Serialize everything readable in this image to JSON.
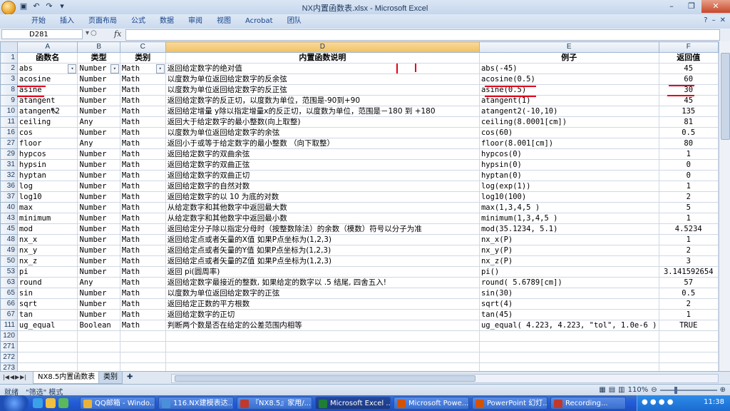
{
  "window": {
    "title": "NX内置函数表.xlsx - Microsoft Excel"
  },
  "ribbon": {
    "tabs": [
      "开始",
      "插入",
      "页面布局",
      "公式",
      "数据",
      "审阅",
      "视图",
      "Acrobat",
      "团队"
    ]
  },
  "formula_bar": {
    "name_box": "D281",
    "fx": "fx",
    "value": ""
  },
  "columns": [
    "A",
    "B",
    "C",
    "D",
    "E",
    "F"
  ],
  "header_row": {
    "row": "1",
    "cells": [
      "函数名",
      "类型",
      "类别",
      "内置函数说明",
      "例子",
      "返回值"
    ]
  },
  "rows": [
    {
      "row": "2",
      "name": "abs",
      "type": "Number",
      "category": "Math",
      "desc": "返回给定数字的绝对值",
      "example": "abs(-45)",
      "result": "45"
    },
    {
      "row": "3",
      "name": "acosine",
      "type": "Number",
      "category": "Math",
      "desc": "以度数为单位返回给定数字的反余弦",
      "example": "acosine(0.5)",
      "result": "60"
    },
    {
      "row": "8",
      "name": "asine",
      "type": "Number",
      "category": "Math",
      "desc": "以度数为单位返回给定数字的反正弦",
      "example": "asine(0.5)",
      "result": "30"
    },
    {
      "row": "9",
      "name": "atangent",
      "type": "Number",
      "category": "Math",
      "desc": "返回给定数字的反正切，以度数为单位，范围是-90到+90",
      "example": "atangent(1)",
      "result": "45"
    },
    {
      "row": "10",
      "name": "atangent2",
      "type": "Number",
      "category": "Math",
      "desc": "返回给定增量 y除以指定增量x的反正切，以度数为单位，范围是－180 到 +180",
      "example": "atangent2(-10,10)",
      "result": "135"
    },
    {
      "row": "11",
      "name": "ceiling",
      "type": "Any",
      "category": "Math",
      "desc": "返回大于给定数字的最小整数(向上取整)",
      "example": "ceiling(8.0001[cm])",
      "result": "81"
    },
    {
      "row": "16",
      "name": "cos",
      "type": "Number",
      "category": "Math",
      "desc": "以度数为单位返回给定数字的余弦",
      "example": "cos(60)",
      "result": "0.5"
    },
    {
      "row": "27",
      "name": "floor",
      "type": "Any",
      "category": "Math",
      "desc": "返回小于或等于给定数字的最小整数 （向下取整）",
      "example": "floor(8.001[cm])",
      "result": "80"
    },
    {
      "row": "29",
      "name": "hypcos",
      "type": "Number",
      "category": "Math",
      "desc": "返回给定数字的双曲余弦",
      "example": "hypcos(0)",
      "result": "1"
    },
    {
      "row": "31",
      "name": "hypsin",
      "type": "Number",
      "category": "Math",
      "desc": "返回给定数字的双曲正弦",
      "example": "hypsin(0)",
      "result": "0"
    },
    {
      "row": "32",
      "name": "hyptan",
      "type": "Number",
      "category": "Math",
      "desc": "返回给定数字的双曲正切",
      "example": "hyptan(0)",
      "result": "0"
    },
    {
      "row": "36",
      "name": "log",
      "type": "Number",
      "category": "Math",
      "desc": "返回给定数字的自然对数",
      "example": "log(exp(1))",
      "result": "1"
    },
    {
      "row": "37",
      "name": "log10",
      "type": "Number",
      "category": "Math",
      "desc": "返回给定数字的以 10 为底的对数",
      "example": "log10(100)",
      "result": "2"
    },
    {
      "row": "40",
      "name": "max",
      "type": "Number",
      "category": "Math",
      "desc": "从给定数字和其他数字中返回最大数",
      "example": "max(1,3,4,5 )",
      "result": "5"
    },
    {
      "row": "43",
      "name": "minimum",
      "type": "Number",
      "category": "Math",
      "desc": "从给定数字和其他数字中返回最小数",
      "example": "minimum(1,3,4,5 )",
      "result": "1"
    },
    {
      "row": "45",
      "name": "mod",
      "type": "Number",
      "category": "Math",
      "desc": "返回给定分子除以指定分母时（按整数除法）的余数（模数）符号以分子为准",
      "example": "mod(35.1234, 5.1)",
      "result": "4.5234"
    },
    {
      "row": "48",
      "name": "nx_x",
      "type": "Number",
      "category": "Math",
      "desc": "返回给定点或者矢量的X值 如果P点坐标为(1,2,3)",
      "example": "nx_x(P)",
      "result": "1"
    },
    {
      "row": "49",
      "name": "nx_y",
      "type": "Number",
      "category": "Math",
      "desc": "返回给定点或者矢量的Y值 如果P点坐标为(1,2,3)",
      "example": "nx_y(P)",
      "result": "2"
    },
    {
      "row": "50",
      "name": "nx_z",
      "type": "Number",
      "category": "Math",
      "desc": "返回给定点或者矢量的Z值 如果P点坐标为(1,2,3)",
      "example": "nx_z(P)",
      "result": "3"
    },
    {
      "row": "53",
      "name": "pi",
      "type": "Number",
      "category": "Math",
      "desc": "返回 pi(圆周率)",
      "example": "pi()",
      "result": "3.141592654"
    },
    {
      "row": "63",
      "name": "round",
      "type": "Any",
      "category": "Math",
      "desc": "返回给定数字最接近的整数, 如果给定的数字以 .5 结尾, 四舍五入!",
      "example": "round( 5.6789[cm])",
      "result": "57"
    },
    {
      "row": "65",
      "name": "sin",
      "type": "Number",
      "category": "Math",
      "desc": "以度数为单位返回给定数字的正弦",
      "example": "sin(30)",
      "result": "0.5"
    },
    {
      "row": "66",
      "name": "sqrt",
      "type": "Number",
      "category": "Math",
      "desc": "返回给定正数的平方根数",
      "example": "sqrt(4)",
      "result": "2"
    },
    {
      "row": "67",
      "name": "tan",
      "type": "Number",
      "category": "Math",
      "desc": "返回给定数字的正切",
      "example": "tan(45)",
      "result": "1"
    },
    {
      "row": "111",
      "name": "ug_equal",
      "type": "Boolean",
      "category": "Math",
      "desc": "判断两个数是否在给定的公差范围内相等",
      "example": "ug_equal( 4.223, 4.223, \"tol\", 1.0e-6 )",
      "result": "TRUE"
    }
  ],
  "empty_rows": [
    "120",
    "271",
    "272",
    "273",
    "274"
  ],
  "sheets": {
    "active": "NX8.5内置函数表",
    "other": "类别"
  },
  "status": {
    "ready": "就绪",
    "mode": "\"筛选\" 模式",
    "zoom": "110%"
  },
  "taskbar": {
    "items": [
      "QQ邮箱 - Windo...",
      "116.NX建模表达...",
      "『NX8.5』家用/...",
      "Microsoft Excel ...",
      "Microsoft Powe...",
      "PowerPoint 幻灯...",
      "Recording..."
    ],
    "clock": "11:38"
  },
  "colors": {
    "annotation_red": "#e0001a",
    "selected_header": "#f1c15f",
    "taskbar_blue": "#245edb"
  }
}
